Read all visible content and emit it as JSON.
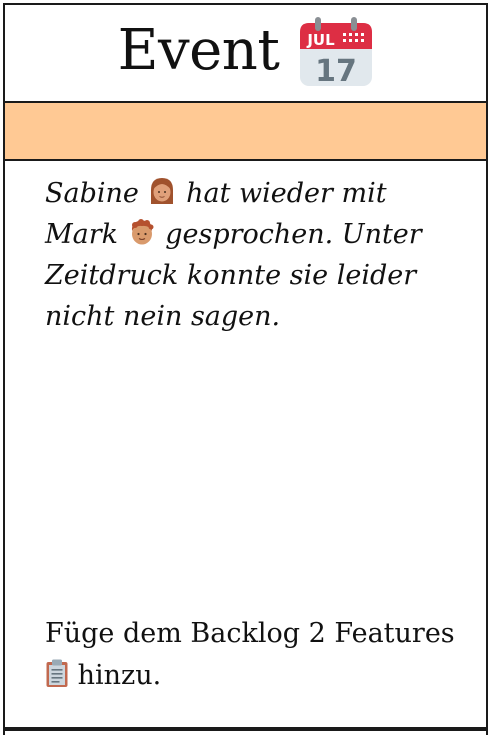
{
  "card": {
    "title": "Event",
    "title_icon": "calendar-icon",
    "calendar_icon": {
      "month": "JUL",
      "day": "17"
    },
    "band_color": "#ffc994",
    "story": {
      "part1": "Sabine",
      "part2": "hat wieder mit",
      "part3": "Mark",
      "part4": "gesprochen. Unter Zeitdruck konnte sie leider nicht nein sagen.",
      "icons": [
        "woman-icon",
        "man-icon"
      ]
    },
    "action": {
      "text1": "Füge dem Backlog 2 Features",
      "text2": "hinzu.",
      "icon": "clipboard-icon"
    }
  }
}
